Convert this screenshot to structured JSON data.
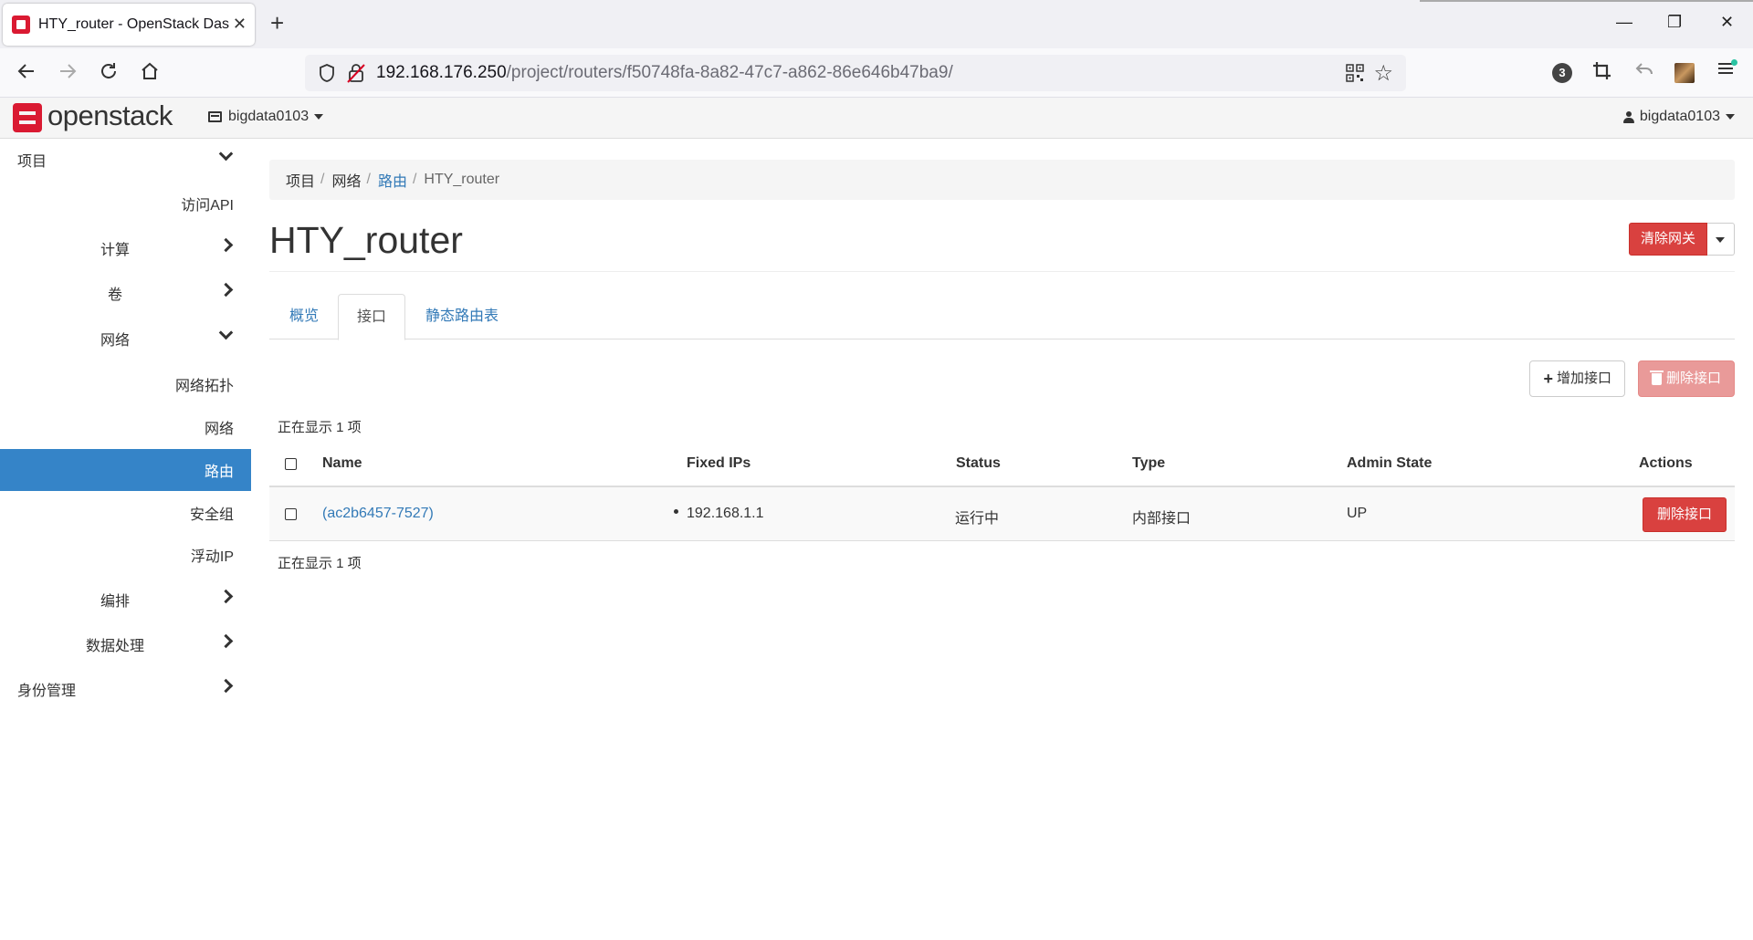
{
  "browser": {
    "tab_title": "HTY_router - OpenStack Dashboard",
    "tab_close": "✕",
    "new_tab": "+",
    "url_host": "192.168.176.250",
    "url_path": "/project/routers/f50748fa-8a82-47c7-a862-86e646b47ba9/",
    "ext_badge": "3",
    "window_controls": {
      "minimize": "—",
      "restore": "❐",
      "close": "✕"
    }
  },
  "header": {
    "logo_text": "openstack",
    "project": "bigdata0103",
    "user": "bigdata0103"
  },
  "sidebar": {
    "items": [
      {
        "label": "项目"
      },
      {
        "label": "访问API"
      },
      {
        "label": "计算"
      },
      {
        "label": "卷"
      },
      {
        "label": "网络"
      },
      {
        "label": "网络拓扑"
      },
      {
        "label": "网络"
      },
      {
        "label": "路由"
      },
      {
        "label": "安全组"
      },
      {
        "label": "浮动IP"
      },
      {
        "label": "编排"
      },
      {
        "label": "数据处理"
      },
      {
        "label": "身份管理"
      }
    ]
  },
  "breadcrumb": {
    "items": [
      "项目",
      "网络",
      "路由",
      "HTY_router"
    ],
    "separator": "/"
  },
  "page": {
    "title": "HTY_router",
    "clear_gateway_label": "清除网关"
  },
  "tabs": [
    {
      "label": "概览"
    },
    {
      "label": "接口"
    },
    {
      "label": "静态路由表"
    }
  ],
  "actions": {
    "add_interface": "增加接口",
    "delete_interfaces": "删除接口"
  },
  "table": {
    "count_text": "正在显示 1 项",
    "columns": [
      "Name",
      "Fixed IPs",
      "Status",
      "Type",
      "Admin State",
      "Actions"
    ],
    "rows": [
      {
        "name": "(ac2b6457-7527)",
        "fixed_ip": "192.168.1.1",
        "status": "运行中",
        "type": "内部接口",
        "admin_state": "UP",
        "action": "删除接口"
      }
    ]
  },
  "colors": {
    "brand": "#da1a32",
    "active_nav": "#3584c8",
    "link": "#337ab7",
    "danger": "#d9413f"
  }
}
